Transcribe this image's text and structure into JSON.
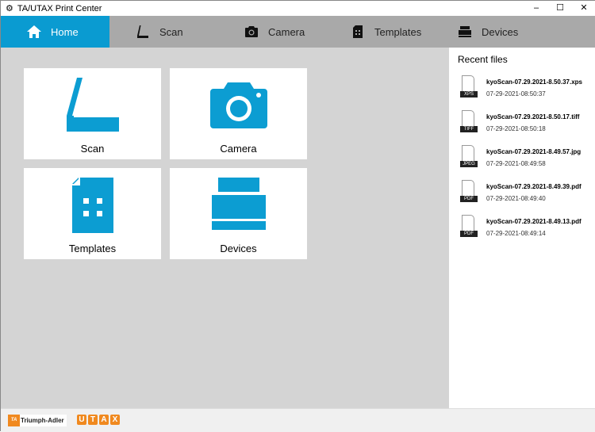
{
  "window": {
    "title": "TA/UTAX Print Center",
    "minimize": "–",
    "maximize": "☐",
    "close": "✕"
  },
  "nav": {
    "tabs": [
      {
        "label": "Home"
      },
      {
        "label": "Scan"
      },
      {
        "label": "Camera"
      },
      {
        "label": "Templates"
      },
      {
        "label": "Devices"
      }
    ]
  },
  "tiles": [
    {
      "label": "Scan"
    },
    {
      "label": "Camera"
    },
    {
      "label": "Templates"
    },
    {
      "label": "Devices"
    }
  ],
  "recent": {
    "title": "Recent files",
    "files": [
      {
        "type": "XPS",
        "name": "kyoScan-07.29.2021-8.50.37.xps",
        "date": "07-29-2021-08:50:37"
      },
      {
        "type": "TIFF",
        "name": "kyoScan-07.29.2021-8.50.17.tiff",
        "date": "07-29-2021-08:50:18"
      },
      {
        "type": "JPEG",
        "name": "kyoScan-07.29.2021-8.49.57.jpg",
        "date": "07-29-2021-08:49:58"
      },
      {
        "type": "PDF",
        "name": "kyoScan-07.29.2021-8.49.39.pdf",
        "date": "07-29-2021-08:49:40"
      },
      {
        "type": "PDF",
        "name": "kyoScan-07.29.2021-8.49.13.pdf",
        "date": "07-29-2021-08:49:14"
      }
    ]
  },
  "footer": {
    "ta_mark": "TA",
    "ta_name": "Triumph-Adler",
    "utax": [
      "U",
      "T",
      "A",
      "X"
    ]
  },
  "colors": {
    "accent": "#0a9bd1",
    "nav": "#a9a9a9",
    "main": "#d4d4d4"
  }
}
